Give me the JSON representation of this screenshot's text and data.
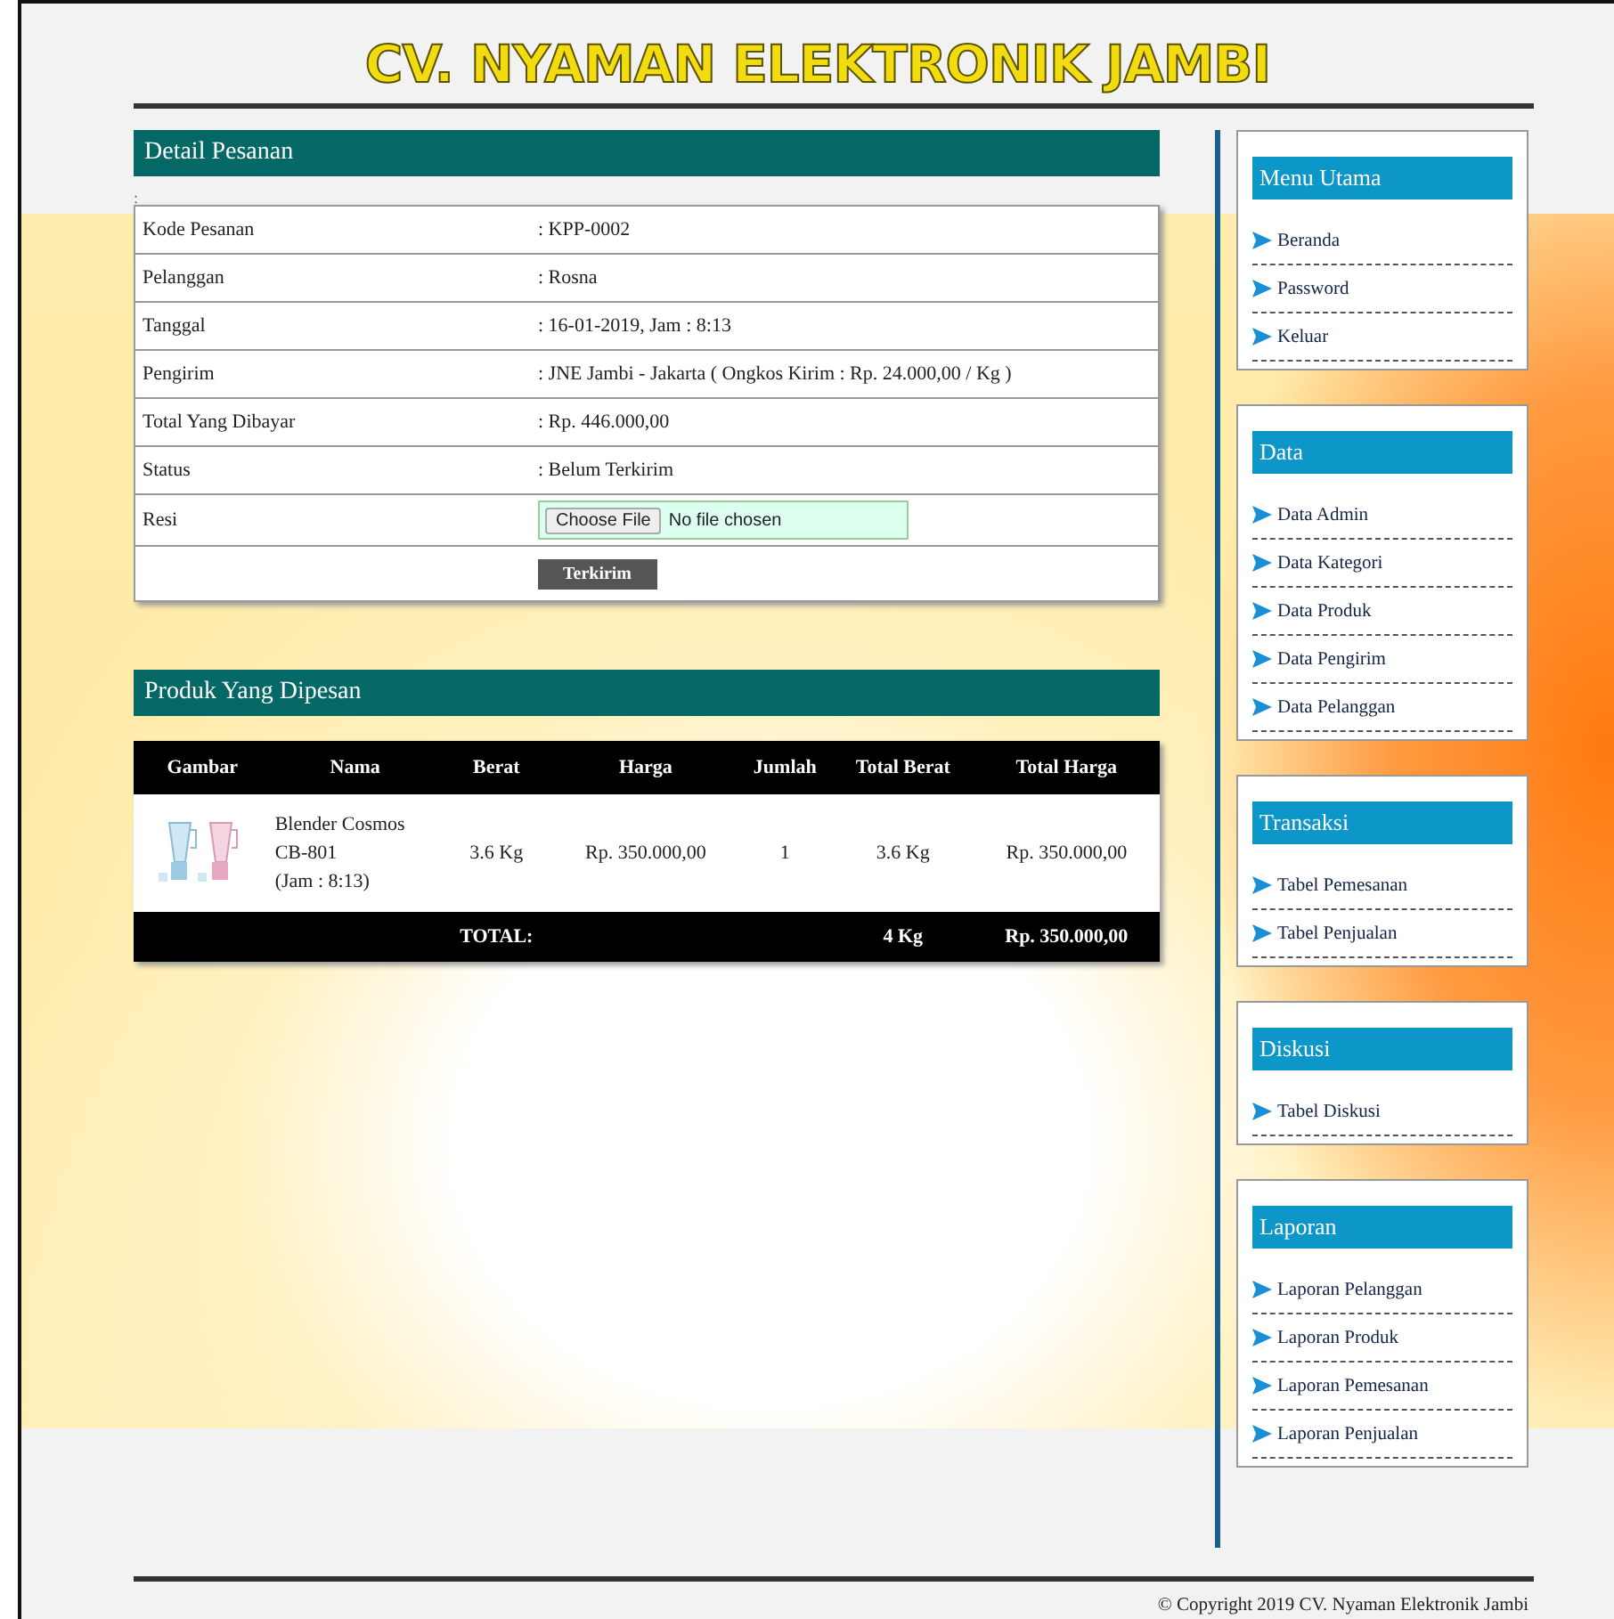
{
  "site_title": "CV. NYAMAN ELEKTRONIK JAMBI",
  "order_detail": {
    "title": "Detail Pesanan",
    "separator_mark": ":",
    "rows": [
      {
        "kind": "text",
        "label": "Kode Pesanan",
        "value": ": KPP-0002"
      },
      {
        "kind": "text",
        "label": "Pelanggan",
        "value": ": Rosna"
      },
      {
        "kind": "text",
        "label": "Tanggal",
        "value": ": 16-01-2019, Jam : 8:13"
      },
      {
        "kind": "text",
        "label": "Pengirim",
        "value": ": JNE Jambi - Jakarta ( Ongkos Kirim : Rp. 24.000,00 / Kg )"
      },
      {
        "kind": "text",
        "label": "Total Yang Dibayar",
        "value": ": Rp. 446.000,00"
      },
      {
        "kind": "text",
        "label": "Status",
        "value": ": Belum Terkirim"
      },
      {
        "kind": "file",
        "label": "Resi",
        "button": "Choose File",
        "value": "No file chosen"
      }
    ],
    "submit_button": "Terkirim"
  },
  "ordered_products": {
    "title": "Produk Yang Dipesan",
    "columns": [
      "Gambar",
      "Nama",
      "Berat",
      "Harga",
      "Jumlah",
      "Total Berat",
      "Total Harga"
    ],
    "rows": [
      {
        "name": "Blender Cosmos CB-801",
        "time": "(Jam : 8:13)",
        "weight": "3.6 Kg",
        "price": "Rp. 350.000,00",
        "quantity": "1",
        "total_weight": "3.6 Kg",
        "total_price": "Rp. 350.000,00"
      }
    ],
    "total": {
      "label": "TOTAL:",
      "weight": "4 Kg",
      "price": "Rp. 350.000,00"
    }
  },
  "sidebar": [
    {
      "title": "Menu Utama",
      "items": [
        "Beranda",
        "Password",
        "Keluar"
      ]
    },
    {
      "title": "Data",
      "items": [
        "Data Admin",
        "Data Kategori",
        "Data Produk",
        "Data Pengirim",
        "Data Pelanggan"
      ]
    },
    {
      "title": "Transaksi",
      "items": [
        "Tabel Pemesanan",
        "Tabel Penjualan"
      ]
    },
    {
      "title": "Diskusi",
      "items": [
        "Tabel Diskusi"
      ]
    },
    {
      "title": "Laporan",
      "items": [
        "Laporan Pelanggan",
        "Laporan Produk",
        "Laporan Pemesanan",
        "Laporan Penjualan"
      ]
    }
  ],
  "footer": "© Copyright 2019 CV. Nyaman Elektronik Jambi"
}
